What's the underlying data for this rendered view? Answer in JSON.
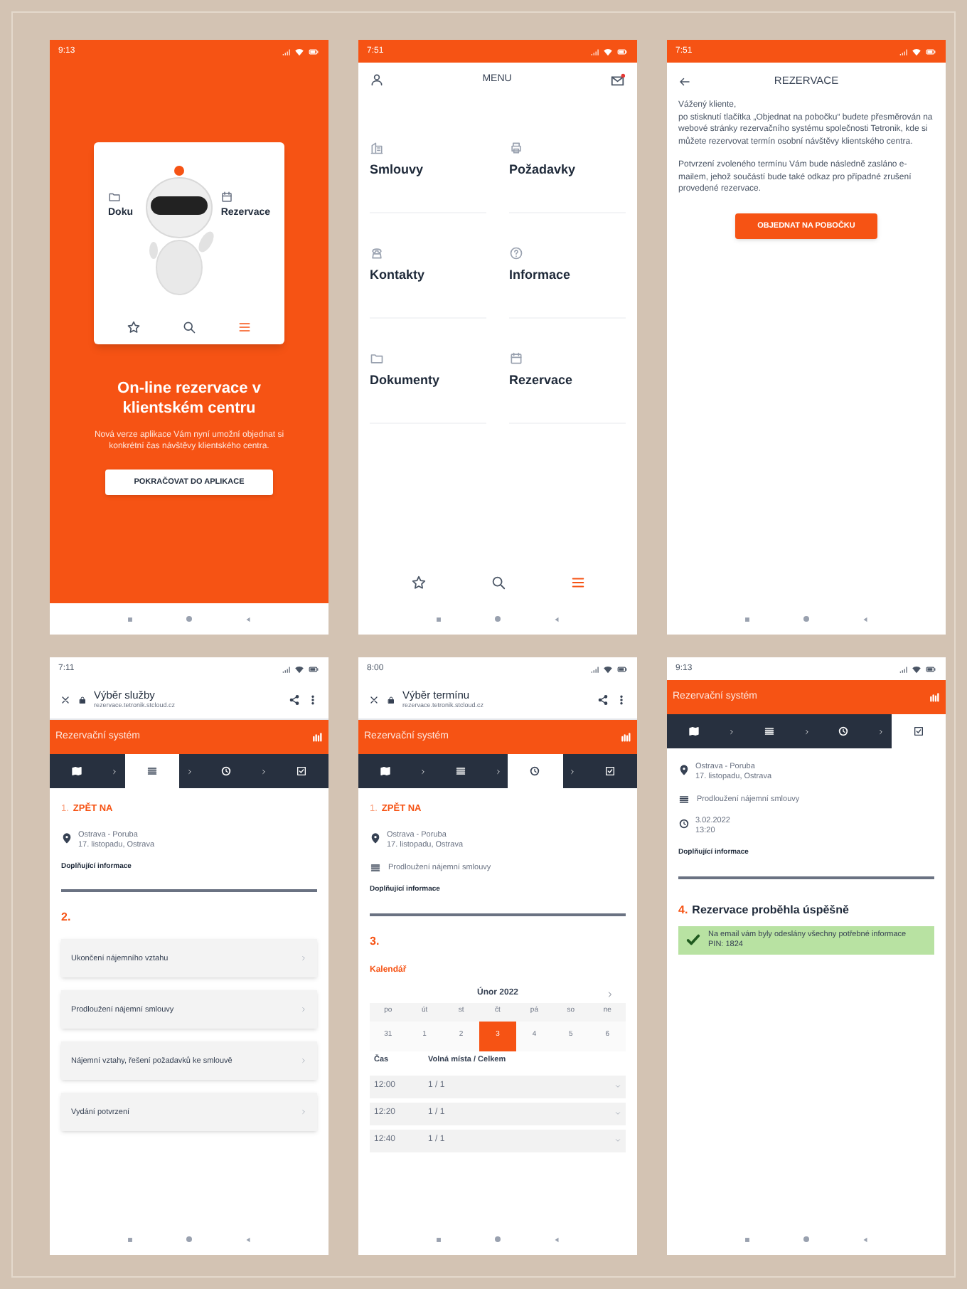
{
  "screens": [
    {
      "kind": "splash",
      "status_time": "9:13",
      "card": {
        "items": [
          "Doku",
          "Rezervace"
        ],
        "nav": [
          {
            "selected": false
          },
          {
            "selected": false
          },
          {
            "selected": true
          }
        ]
      },
      "title": "On-line rezervace v klientském centru",
      "text": "Nová verze aplikace Vám nyní umožní objednat si konkrétní čas návštěvy klientského centra.",
      "button": "POKRAČOVAT DO APLIKACE"
    },
    {
      "kind": "menu",
      "status_time": "7:51",
      "title": "MENU",
      "items": [
        "Smlouvy",
        "Požadavky",
        "Kontakty",
        "Informace",
        "Dokumenty",
        "Rezervace"
      ],
      "nav": [
        {
          "selected": false
        },
        {
          "selected": false
        },
        {
          "selected": true
        }
      ]
    },
    {
      "kind": "info",
      "status_time": "7:51",
      "title": "REZERVACE",
      "paragraphs": [
        "Vážený kliente,\npo stisknutí tlačítka „Objednat na pobočku“ budete přesměrován na webové stránky rezervačního systému společnosti Tetronik, kde si můžete rezervovat termín osobní návštěvy klientského centra.",
        "Potvrzení zvoleného termínu Vám bude následně zasláno e-mailem, jehož součástí bude také odkaz pro případné zrušení provedené rezervace."
      ],
      "button": "OBJEDNAT NA POBOČKU"
    },
    {
      "kind": "services",
      "status_time": "7:11",
      "browser": {
        "title": "Výběr služby",
        "url": "rezervace.tetronik.stcloud.cz"
      },
      "app_title": "Rezervační systém",
      "steps": [
        {
          "selected": false
        },
        {
          "selected": true
        },
        {
          "selected": false
        },
        {
          "selected": false
        }
      ],
      "back_link": {
        "number": "1.",
        "label": "ZPĚT NA"
      },
      "location": {
        "name": "Ostrava - Poruba",
        "address": "17. listopadu, Ostrava"
      },
      "info_label": "Doplňující informace",
      "section": "2.",
      "services": [
        "Ukončení nájemního vztahu",
        "Prodloužení nájemní smlouvy",
        "Nájemní vztahy, řešení požadavků ke smlouvě",
        "Vydání potvrzení"
      ]
    },
    {
      "kind": "calendar",
      "status_time": "8:00",
      "browser": {
        "title": "Výběr termínu",
        "url": "rezervace.tetronik.stcloud.cz"
      },
      "app_title": "Rezervační systém",
      "steps": [
        {
          "selected": false
        },
        {
          "selected": false
        },
        {
          "selected": true
        },
        {
          "selected": false
        }
      ],
      "back_link": {
        "number": "1.",
        "label": "ZPĚT NA"
      },
      "location": {
        "name": "Ostrava - Poruba",
        "address": "17. listopadu, Ostrava"
      },
      "service": "Prodloužení nájemní smlouvy",
      "info_label": "Doplňující informace",
      "section": "3.",
      "calendar": {
        "label": "Kalendář",
        "month": "Únor 2022",
        "weekdays": [
          "po",
          "út",
          "st",
          "čt",
          "pá",
          "so",
          "ne"
        ],
        "days": [
          {
            "day": "31",
            "selected": false
          },
          {
            "day": "1",
            "selected": false
          },
          {
            "day": "2",
            "selected": false
          },
          {
            "day": "3",
            "selected": true
          },
          {
            "day": "4",
            "selected": false
          },
          {
            "day": "5",
            "selected": false
          },
          {
            "day": "6",
            "selected": false
          }
        ],
        "columns": [
          "Čas",
          "Volná místa / Celkem"
        ],
        "slots": [
          {
            "time": "12:00",
            "capacity": "1 / 1"
          },
          {
            "time": "12:20",
            "capacity": "1 / 1"
          },
          {
            "time": "12:40",
            "capacity": "1 / 1"
          }
        ]
      }
    },
    {
      "kind": "done",
      "status_time": "9:13",
      "app_title": "Rezervační systém",
      "steps": [
        {
          "selected": false
        },
        {
          "selected": false
        },
        {
          "selected": false
        },
        {
          "selected": true
        }
      ],
      "location": {
        "name": "Ostrava - Poruba",
        "address": "17. listopadu, Ostrava"
      },
      "service": "Prodloužení nájemní smlouvy",
      "datetime": {
        "date": "3.02.2022",
        "time": "13:20"
      },
      "info_label": "Doplňující informace",
      "result": {
        "number": "4.",
        "title": "Rezervace proběhla úspěšně",
        "message": "Na email vám byly odeslány všechny potřebné informace",
        "pin": "PIN: 1824"
      }
    }
  ]
}
